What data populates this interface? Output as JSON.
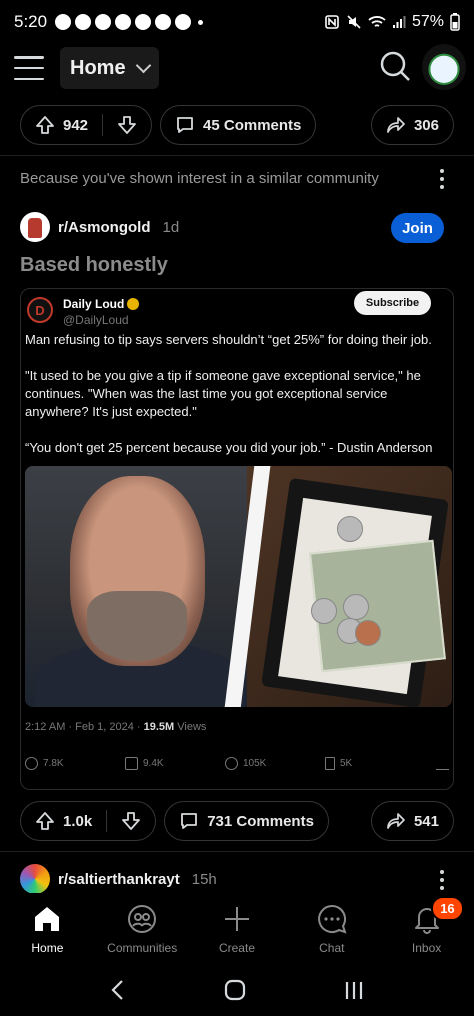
{
  "status_bar": {
    "time": "5:20",
    "battery": "57%"
  },
  "app_bar": {
    "feed_label": "Home"
  },
  "top_post_actions": {
    "votes": "942",
    "comments": "45 Comments",
    "shares": "306"
  },
  "recommendation_reason": "Because you've shown interest in a similar community",
  "post": {
    "subreddit": "r/Asmongold",
    "age": "1d",
    "join_label": "Join",
    "title": "Based honestly",
    "embed": {
      "name": "Daily Loud",
      "handle": "@DailyLoud",
      "subscribe_label": "Subscribe",
      "paragraphs": [
        "Man refusing to tip says servers shouldn’t “get 25%” for doing their job.",
        "\"It used to be you give a tip if someone gave exceptional service,\" he continues. \"When was the last time you got exceptional service anywhere? It's just expected.\"",
        "“You don't get 25 percent because you did your job.” - Dustin Anderson"
      ],
      "timestamp": "2:12 AM · Feb 1, 2024 · ",
      "views_count": "19.5M",
      "views_label": " Views",
      "stats": {
        "replies": "7.8K",
        "reposts": "9.4K",
        "likes": "105K",
        "bookmarks": "5K"
      }
    },
    "actions": {
      "votes": "1.0k",
      "comments": "731 Comments",
      "shares": "541"
    }
  },
  "next_post": {
    "subreddit": "r/saltierthankrayt",
    "age": "15h"
  },
  "bottom_nav": {
    "home": "Home",
    "communities": "Communities",
    "create": "Create",
    "chat": "Chat",
    "inbox": "Inbox",
    "inbox_badge": "16"
  },
  "colors": {
    "join_blue": "#0b5fd6",
    "badge_orange": "#ff4500"
  }
}
